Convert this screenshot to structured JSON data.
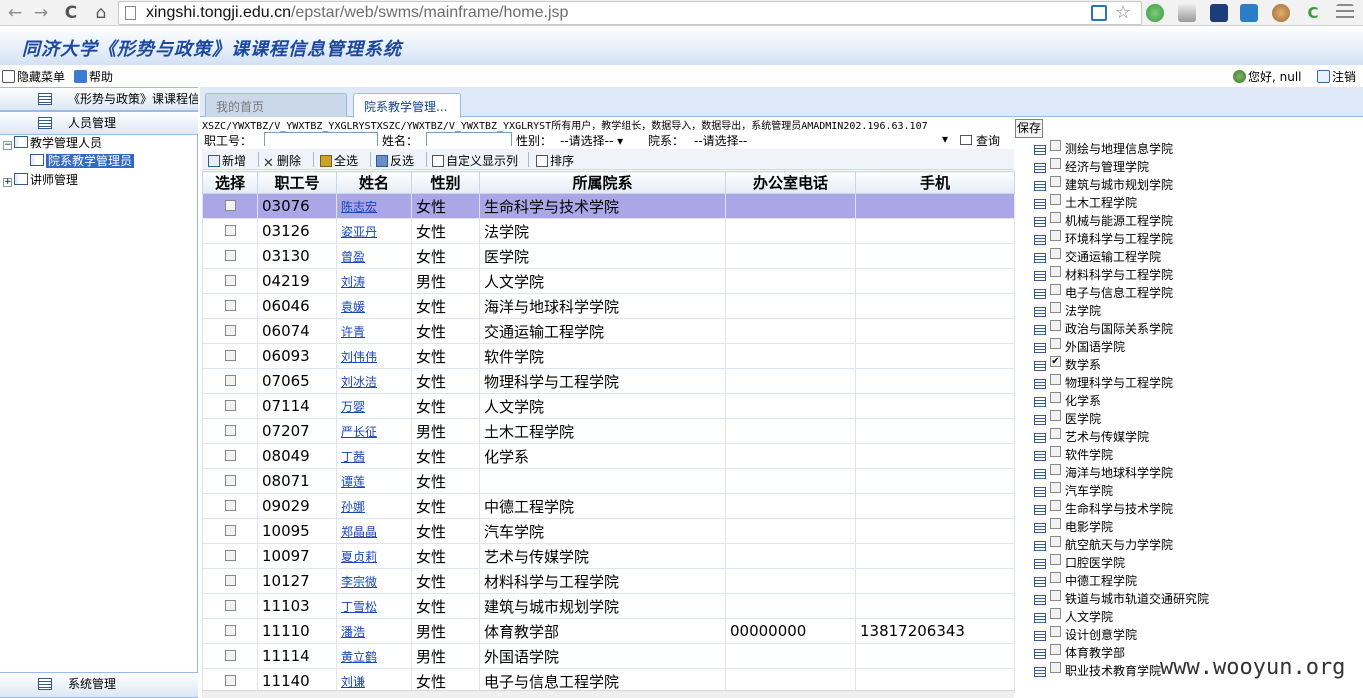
{
  "browser": {
    "url_host": "xingshi.tongji.edu.cn",
    "url_path": "/epstar/web/swms/mainframe/home.jsp",
    "back": "←",
    "forward": "→",
    "reload": "C",
    "home": "⌂"
  },
  "app": {
    "title": "同济大学《形势与政策》课课程信息管理系统",
    "hide_menu": "隐藏菜单",
    "help": "帮助",
    "greeting": "您好, null",
    "logout": "注销"
  },
  "sidebar": {
    "top_section": "《形势与政策》课课程信息",
    "personnel_section": "人员管理",
    "tree": [
      {
        "label": "教学管理人员",
        "exp": "−"
      },
      {
        "label": "院系教学管理员"
      },
      {
        "label": "讲师管理",
        "exp": "+"
      }
    ],
    "system_section": "系统管理"
  },
  "tabs": [
    {
      "label": "我的首页"
    },
    {
      "label": "院系教学管理..."
    }
  ],
  "info_line": "XSZC/YWXTBZ/V_YWXTBZ_YXGLRYSTXSZC/YWXTBZ/V_YWXTBZ_YXGLRYST所有用户，教学组长，数据导入，数据导出，系统管理员AMADMIN202.196.63.107",
  "search": {
    "staff_no_label": "职工号：",
    "name_label": "姓名：",
    "gender_label": "性别：",
    "gender_value": "--请选择--",
    "dept_label": "院系：",
    "dept_value": "--请选择--",
    "query_label": "查询"
  },
  "grid_toolbar": {
    "add": "新增",
    "delete": "删除",
    "select_all": "全选",
    "invert": "反选",
    "custom_columns": "自定义显示列",
    "sort": "排序"
  },
  "grid": {
    "headers": [
      "选择",
      "职工号",
      "姓名",
      "性别",
      "所属院系",
      "办公室电话",
      "手机"
    ],
    "rows": [
      {
        "id": "03076",
        "name": "陈志宏",
        "gender": "女性",
        "dept": "生命科学与技术学院",
        "phone": "",
        "mobile": ""
      },
      {
        "id": "03126",
        "name": "姿亚丹",
        "gender": "女性",
        "dept": "法学院",
        "phone": "",
        "mobile": ""
      },
      {
        "id": "03130",
        "name": "曾盈",
        "gender": "女性",
        "dept": "医学院",
        "phone": "",
        "mobile": ""
      },
      {
        "id": "04219",
        "name": "刘涛",
        "gender": "男性",
        "dept": "人文学院",
        "phone": "",
        "mobile": ""
      },
      {
        "id": "06046",
        "name": "袁媛",
        "gender": "女性",
        "dept": "海洋与地球科学学院",
        "phone": "",
        "mobile": ""
      },
      {
        "id": "06074",
        "name": "许青",
        "gender": "女性",
        "dept": "交通运输工程学院",
        "phone": "",
        "mobile": ""
      },
      {
        "id": "06093",
        "name": "刘伟伟",
        "gender": "女性",
        "dept": "软件学院",
        "phone": "",
        "mobile": ""
      },
      {
        "id": "07065",
        "name": "刘冰洁",
        "gender": "女性",
        "dept": "物理科学与工程学院",
        "phone": "",
        "mobile": ""
      },
      {
        "id": "07114",
        "name": "万婴",
        "gender": "女性",
        "dept": "人文学院",
        "phone": "",
        "mobile": ""
      },
      {
        "id": "07207",
        "name": "严长征",
        "gender": "男性",
        "dept": "土木工程学院",
        "phone": "",
        "mobile": ""
      },
      {
        "id": "08049",
        "name": "丁茜",
        "gender": "女性",
        "dept": "化学系",
        "phone": "",
        "mobile": ""
      },
      {
        "id": "08071",
        "name": "谭莲",
        "gender": "女性",
        "dept": "",
        "phone": "",
        "mobile": ""
      },
      {
        "id": "09029",
        "name": "孙娜",
        "gender": "女性",
        "dept": "中德工程学院",
        "phone": "",
        "mobile": ""
      },
      {
        "id": "10095",
        "name": "郑晶晶",
        "gender": "女性",
        "dept": "汽车学院",
        "phone": "",
        "mobile": ""
      },
      {
        "id": "10097",
        "name": "夏贞莉",
        "gender": "女性",
        "dept": "艺术与传媒学院",
        "phone": "",
        "mobile": ""
      },
      {
        "id": "10127",
        "name": "李宗微",
        "gender": "女性",
        "dept": "材料科学与工程学院",
        "phone": "",
        "mobile": ""
      },
      {
        "id": "11103",
        "name": "丁雪松",
        "gender": "女性",
        "dept": "建筑与城市规划学院",
        "phone": "",
        "mobile": ""
      },
      {
        "id": "11110",
        "name": "潘浩",
        "gender": "男性",
        "dept": "体育教学部",
        "phone": "00000000",
        "mobile": "13817206343"
      },
      {
        "id": "11114",
        "name": "黄立鹤",
        "gender": "男性",
        "dept": "外国语学院",
        "phone": "",
        "mobile": ""
      },
      {
        "id": "11140",
        "name": "刘谦",
        "gender": "女性",
        "dept": "电子与信息工程学院",
        "phone": "",
        "mobile": ""
      }
    ]
  },
  "save_label": "保存",
  "departments": [
    {
      "label": "测绘与地理信息学院",
      "checked": false
    },
    {
      "label": "经济与管理学院",
      "checked": false
    },
    {
      "label": "建筑与城市规划学院",
      "checked": false
    },
    {
      "label": "土木工程学院",
      "checked": false
    },
    {
      "label": "机械与能源工程学院",
      "checked": false
    },
    {
      "label": "环境科学与工程学院",
      "checked": false
    },
    {
      "label": "交通运输工程学院",
      "checked": false
    },
    {
      "label": "材料科学与工程学院",
      "checked": false
    },
    {
      "label": "电子与信息工程学院",
      "checked": false
    },
    {
      "label": "法学院",
      "checked": false
    },
    {
      "label": "政治与国际关系学院",
      "checked": false
    },
    {
      "label": "外国语学院",
      "checked": false
    },
    {
      "label": "数学系",
      "checked": true
    },
    {
      "label": "物理科学与工程学院",
      "checked": false
    },
    {
      "label": "化学系",
      "checked": false
    },
    {
      "label": "医学院",
      "checked": false
    },
    {
      "label": "艺术与传媒学院",
      "checked": false
    },
    {
      "label": "软件学院",
      "checked": false
    },
    {
      "label": "海洋与地球科学学院",
      "checked": false
    },
    {
      "label": "汽车学院",
      "checked": false
    },
    {
      "label": "生命科学与技术学院",
      "checked": false
    },
    {
      "label": "电影学院",
      "checked": false
    },
    {
      "label": "航空航天与力学学院",
      "checked": false
    },
    {
      "label": "口腔医学院",
      "checked": false
    },
    {
      "label": "中德工程学院",
      "checked": false
    },
    {
      "label": "铁道与城市轨道交通研究院",
      "checked": false
    },
    {
      "label": "人文学院",
      "checked": false
    },
    {
      "label": "设计创意学院",
      "checked": false
    },
    {
      "label": "体育教学部",
      "checked": false
    },
    {
      "label": "职业技术教育学院",
      "checked": false
    }
  ],
  "watermark": "www.wooyun.org",
  "check_mark": "✔"
}
